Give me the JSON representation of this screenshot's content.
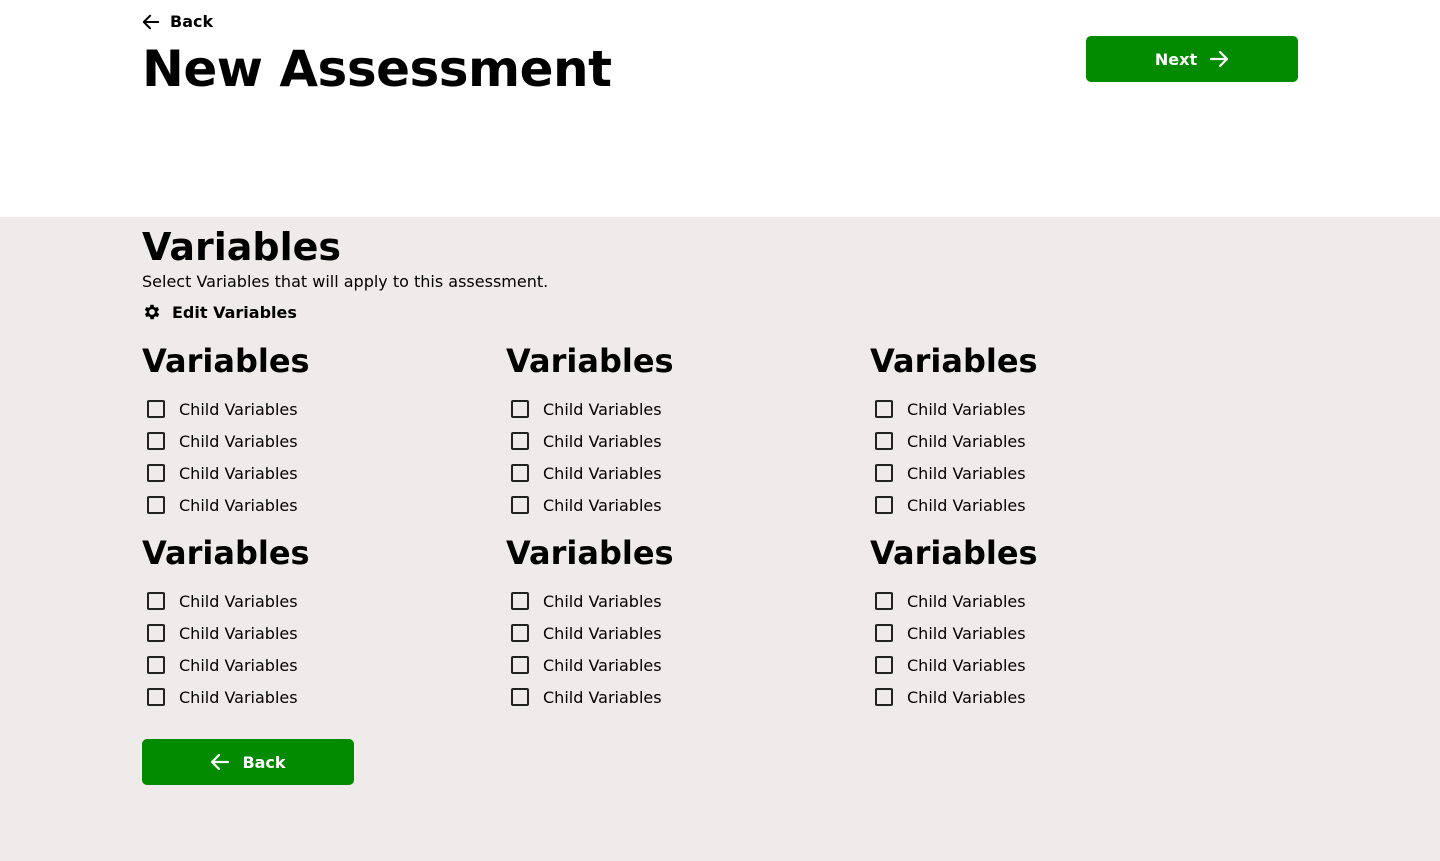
{
  "header": {
    "back_label": "Back",
    "title": "New Assessment",
    "next_label": "Next"
  },
  "section": {
    "title": "Variables",
    "description": "Select Variables that will apply to this assessment.",
    "edit_label": "Edit Variables"
  },
  "groups": [
    {
      "title": "Variables",
      "items": [
        {
          "label": "Child Variables",
          "checked": false
        },
        {
          "label": "Child Variables",
          "checked": false
        },
        {
          "label": "Child Variables",
          "checked": false
        },
        {
          "label": "Child Variables",
          "checked": false
        }
      ]
    },
    {
      "title": "Variables",
      "items": [
        {
          "label": "Child Variables",
          "checked": false
        },
        {
          "label": "Child Variables",
          "checked": false
        },
        {
          "label": "Child Variables",
          "checked": false
        },
        {
          "label": "Child Variables",
          "checked": false
        }
      ]
    },
    {
      "title": "Variables",
      "items": [
        {
          "label": "Child Variables",
          "checked": false
        },
        {
          "label": "Child Variables",
          "checked": false
        },
        {
          "label": "Child Variables",
          "checked": false
        },
        {
          "label": "Child Variables",
          "checked": false
        }
      ]
    },
    {
      "title": "Variables",
      "items": [
        {
          "label": "Child Variables",
          "checked": false
        },
        {
          "label": "Child Variables",
          "checked": false
        },
        {
          "label": "Child Variables",
          "checked": false
        },
        {
          "label": "Child Variables",
          "checked": false
        }
      ]
    },
    {
      "title": "Variables",
      "items": [
        {
          "label": "Child Variables",
          "checked": false
        },
        {
          "label": "Child Variables",
          "checked": false
        },
        {
          "label": "Child Variables",
          "checked": false
        },
        {
          "label": "Child Variables",
          "checked": false
        }
      ]
    },
    {
      "title": "Variables",
      "items": [
        {
          "label": "Child Variables",
          "checked": false
        },
        {
          "label": "Child Variables",
          "checked": false
        },
        {
          "label": "Child Variables",
          "checked": false
        },
        {
          "label": "Child Variables",
          "checked": false
        }
      ]
    }
  ],
  "footer": {
    "back_label": "Back"
  },
  "colors": {
    "accent": "#028a00",
    "content_bg": "#efebea"
  },
  "icons": {
    "back": "arrow-left-icon",
    "next": "arrow-right-icon",
    "edit": "gear-icon"
  }
}
